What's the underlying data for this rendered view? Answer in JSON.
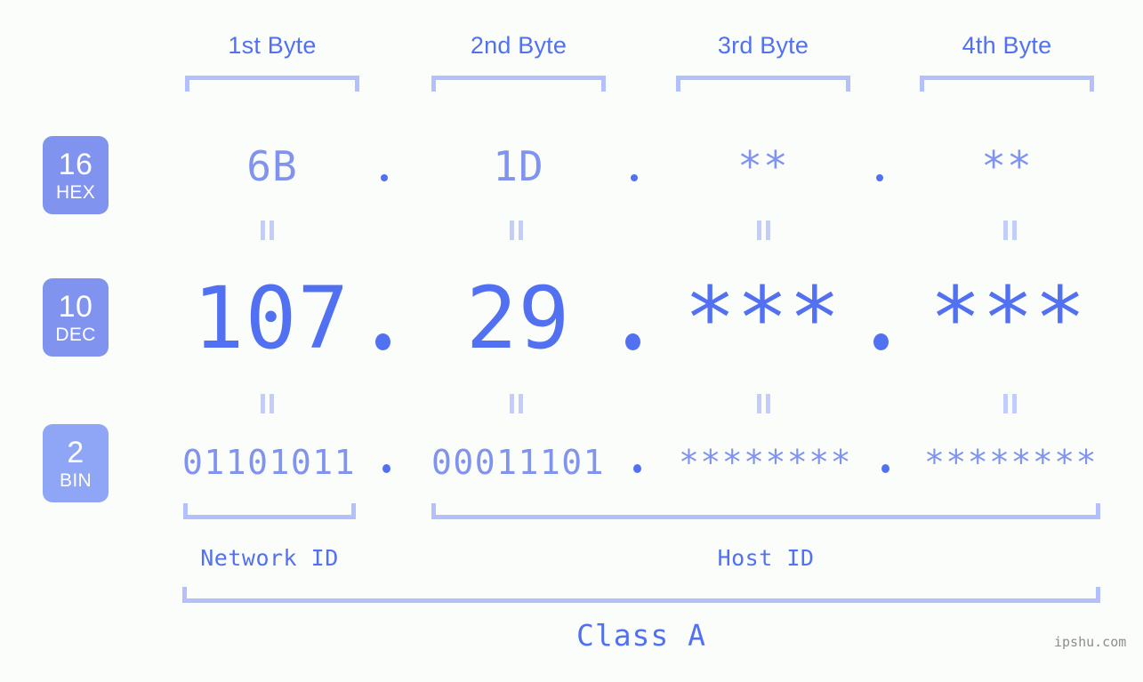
{
  "headers": [
    {
      "label": "1st Byte"
    },
    {
      "label": "2nd Byte"
    },
    {
      "label": "3rd Byte"
    },
    {
      "label": "4th Byte"
    }
  ],
  "rows": [
    {
      "badge_num": "16",
      "badge_name": "HEX",
      "values": [
        "6B",
        "1D",
        "**",
        "**"
      ],
      "separator": "."
    },
    {
      "badge_num": "10",
      "badge_name": "DEC",
      "values": [
        "107",
        "29",
        "***",
        "***"
      ],
      "separator": "."
    },
    {
      "badge_num": "2",
      "badge_name": "BIN",
      "values": [
        "01101011",
        "00011101",
        "********",
        "********"
      ],
      "separator": "."
    }
  ],
  "segments": {
    "network_id": "Network ID",
    "host_id": "Host ID"
  },
  "class_label": "Class A",
  "watermark": "ipshu.com",
  "colors": {
    "background": "#fbfdfa",
    "accent_strong": "#5271f2",
    "accent_mid": "#8093ef",
    "accent_light": "#b3c0fb",
    "accent_faint": "#c3cdfc",
    "badge_bin": "#8fa6f7",
    "watermark": "#8d8d8d"
  }
}
